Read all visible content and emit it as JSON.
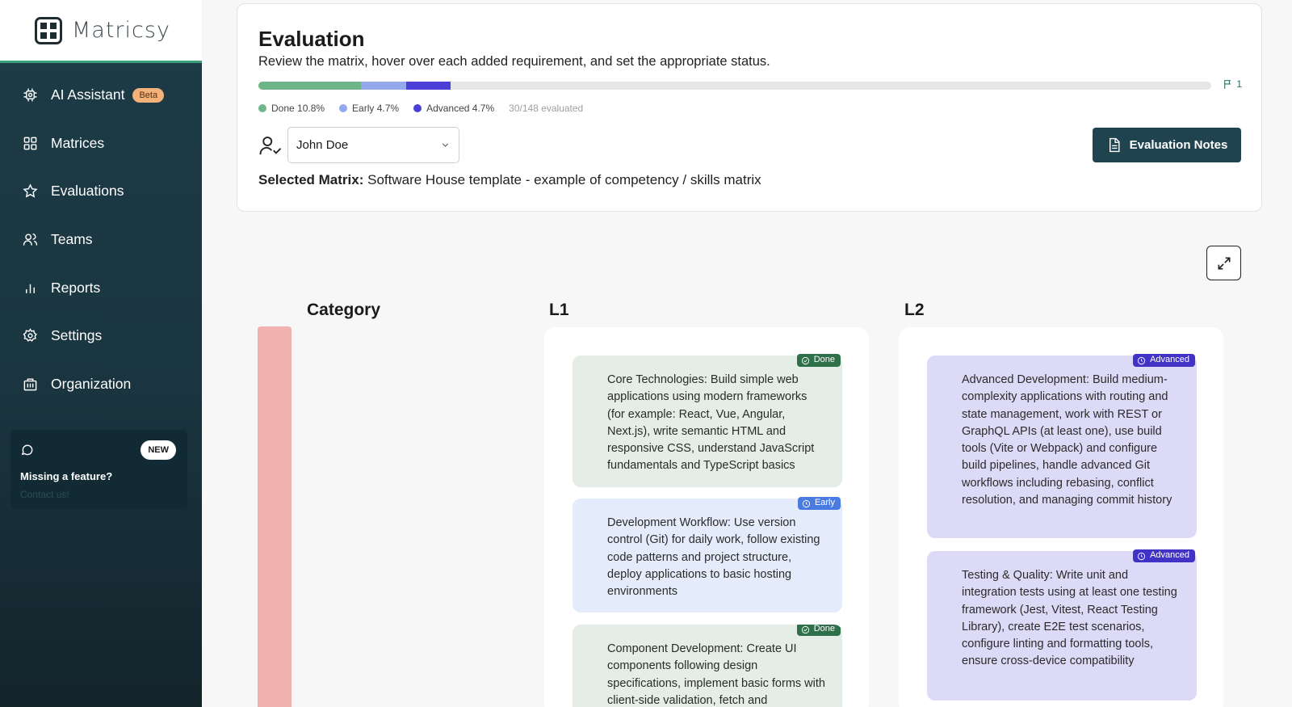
{
  "app": {
    "name": "Matricsy"
  },
  "sidebar": {
    "items": [
      {
        "label": "AI Assistant",
        "icon": "ai-chip-icon",
        "badge": "Beta"
      },
      {
        "label": "Matrices",
        "icon": "grid-icon"
      },
      {
        "label": "Evaluations",
        "icon": "star-icon"
      },
      {
        "label": "Teams",
        "icon": "users-icon"
      },
      {
        "label": "Reports",
        "icon": "bar-chart-icon"
      },
      {
        "label": "Settings",
        "icon": "gear-icon"
      },
      {
        "label": "Organization",
        "icon": "building-icon"
      }
    ],
    "feature_card": {
      "badge": "NEW",
      "title": "Missing a feature?",
      "link": "Contact us!"
    }
  },
  "evaluation": {
    "title": "Evaluation",
    "subtitle": "Review the matrix, hover over each added requirement, and set the appropriate status.",
    "progress": {
      "done_pct": 10.8,
      "early_pct": 4.7,
      "advanced_pct": 4.7
    },
    "flag_count": "1",
    "legend": {
      "done": "Done 10.8%",
      "early": "Early 4.7%",
      "advanced": "Advanced 4.7%",
      "evaluated": "30/148 evaluated"
    },
    "colors": {
      "done": "#6fb58a",
      "early": "#93a9ec",
      "advanced": "#4b3fd6"
    },
    "user_select": {
      "value": "John Doe"
    },
    "notes_button": "Evaluation Notes",
    "selected_matrix": {
      "label": "Selected Matrix:",
      "value": "Software House template - example of competency / skills matrix"
    }
  },
  "matrix": {
    "headers": {
      "category": "Category",
      "l1": "L1",
      "l2": "L2"
    },
    "l1": [
      {
        "status": "Done",
        "text": "Core Technologies: Build simple web applications using modern frameworks (for example: React, Vue, Angular, Next.js), write semantic HTML and responsive CSS, understand JavaScript fundamentals and TypeScript basics"
      },
      {
        "status": "Early",
        "text": "Development Workflow: Use version control (Git) for daily work, follow existing code patterns and project structure, deploy applications to basic hosting environments"
      },
      {
        "status": "Done",
        "text": "Component Development: Create UI components following design specifications, implement basic forms with client-side validation, fetch and"
      }
    ],
    "l2": [
      {
        "status": "Advanced",
        "text": "Advanced Development: Build medium-complexity applications with routing and state management, work with REST or GraphQL APIs (at least one), use build tools (Vite or Webpack) and configure build pipelines, handle advanced Git workflows including rebasing, conflict resolution, and managing commit history"
      },
      {
        "status": "Advanced",
        "text": "Testing & Quality: Write unit and integration tests using at least one testing framework (Jest, Vitest, React Testing Library), create E2E test scenarios, configure linting and formatting tools, ensure cross-device compatibility"
      }
    ]
  }
}
